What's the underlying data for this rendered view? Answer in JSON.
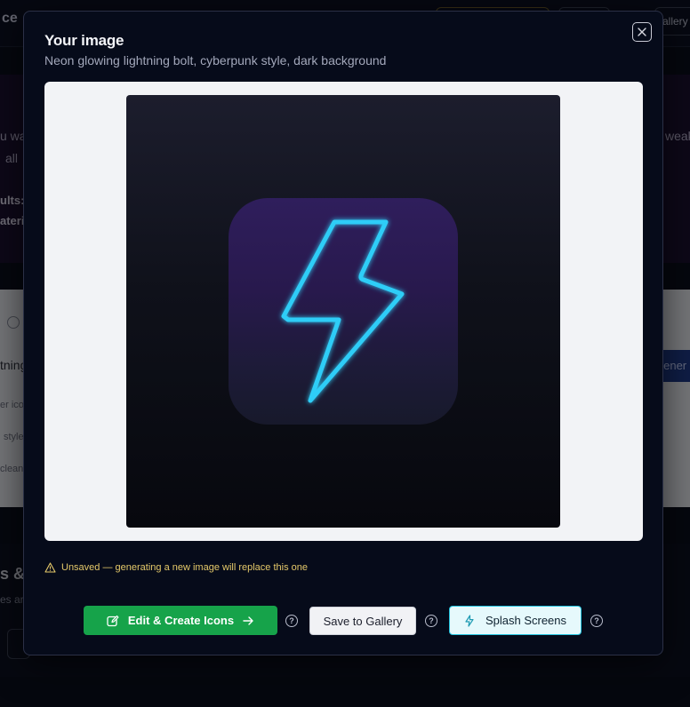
{
  "background": {
    "brand_fragment": "ce",
    "chip_gallery": "allery",
    "hero_fragment_1": "u wa",
    "hero_fragment_2": "all ",
    "hero_fragment_3": "ults:",
    "hero_fragment_4": "ateri",
    "hero_fragment_right": "weak",
    "input_fragment": "tning",
    "hint_fragment_1": "er icon",
    "hint_fragment_2": "style",
    "hint_fragment_3": "clean",
    "generate_fragment": "Gener",
    "footer_title_fragment": "s &",
    "footer_sub_fragment": "es ar"
  },
  "modal": {
    "title": "Your image",
    "subtitle": "Neon glowing lightning bolt, cyberpunk style, dark background",
    "close_icon": "close-icon",
    "warning": "Unsaved — generating a new image will replace this one",
    "buttons": {
      "edit_create": "Edit & Create Icons",
      "save_gallery": "Save to Gallery",
      "splash": "Splash Screens"
    },
    "help_glyph": "?"
  },
  "colors": {
    "primary": "#16a34a",
    "splash_border": "#26c6e0",
    "warning": "#e5c96a",
    "neon": "#38d7ff"
  }
}
